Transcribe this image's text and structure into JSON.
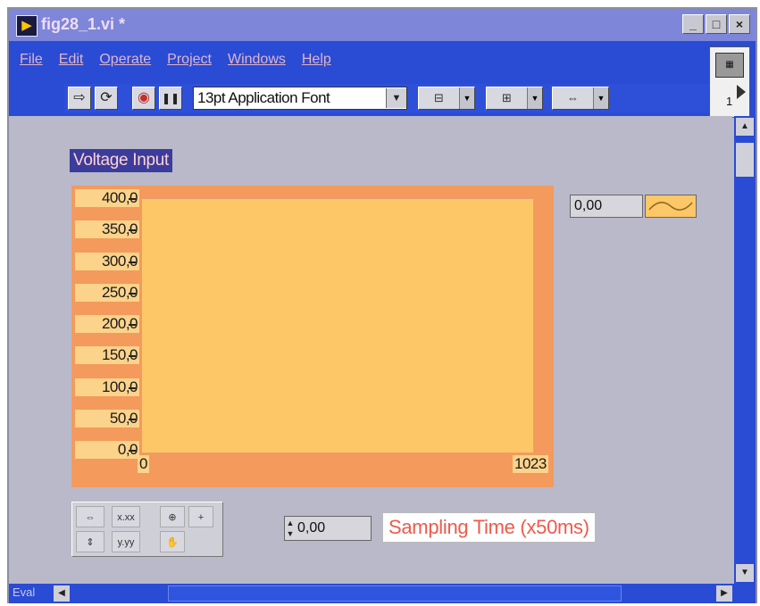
{
  "window": {
    "title": "fig28_1.vi *",
    "minimize": "_",
    "maximize": "□",
    "close": "×"
  },
  "menu": [
    "File",
    "Edit",
    "Operate",
    "Project",
    "Windows",
    "Help"
  ],
  "toolbar": {
    "run_icon": "⇨",
    "run_continuous_icon": "⟳",
    "abort_icon": "◉",
    "pause_icon": "❚❚",
    "font_value": "13pt Application Font",
    "dropdown": "▼"
  },
  "vi_icon": {
    "number": "1"
  },
  "panel": {
    "graph_label": "Voltage Input",
    "legend_value": "0,00",
    "control_value": "0,00",
    "control_label": "Sampling Time (x50ms)"
  },
  "chart_data": {
    "type": "line",
    "title": "",
    "xlabel": "",
    "ylabel": "",
    "xlim": [
      0,
      1023
    ],
    "ylim": [
      0.0,
      400.0
    ],
    "x_ticks": [
      "0",
      "1023"
    ],
    "y_ticks": [
      "400,0",
      "350,0",
      "300,0",
      "250,0",
      "200,0",
      "150,0",
      "100,0",
      "50,0",
      "0,0"
    ],
    "series": [],
    "grid": false
  },
  "status": {
    "text": "Eval"
  },
  "colors": {
    "titlebar": "#7d86d9",
    "menuband": "#2a4bd4",
    "panel": "#b9b9c9",
    "graph_frame": "#f39a5c",
    "plot_area": "#fdc767",
    "label_background": "#3b3c9c",
    "control_label_text": "#ef5a4a"
  }
}
